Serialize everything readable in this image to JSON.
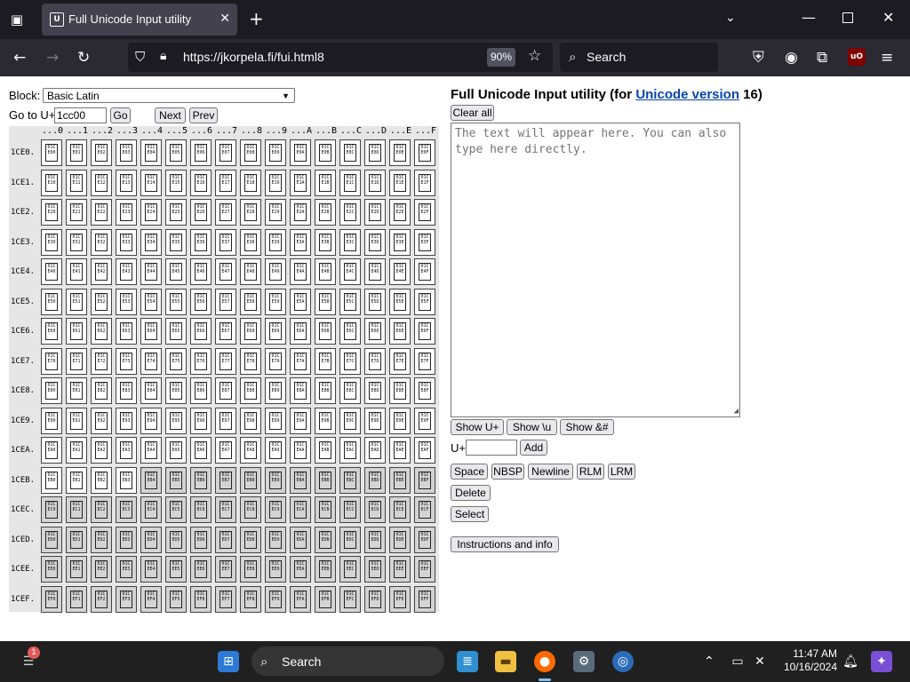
{
  "browser": {
    "tab_title": "Full Unicode Input utility",
    "url": "https://jkorpela.fi/fui.html8",
    "zoom": "90%",
    "search_placeholder": "Search"
  },
  "left": {
    "block_label": "Block:",
    "block_value": "Basic Latin",
    "goto_label": "Go to U+",
    "goto_value": "1cc00",
    "go_button": "Go",
    "next_button": "Next",
    "prev_button": "Prev"
  },
  "grid": {
    "column_headers": [
      "...0",
      "...1",
      "...2",
      "...3",
      "...4",
      "...5",
      "...6",
      "...7",
      "...8",
      "...9",
      "...A",
      "...B",
      "...C",
      "...D",
      "...E",
      "...F"
    ],
    "row_headers": [
      "1CE0.",
      "1CE1.",
      "1CE2.",
      "1CE3.",
      "1CE4.",
      "1CE5.",
      "1CE6.",
      "1CE7.",
      "1CE8.",
      "1CE9.",
      "1CEA.",
      "1CEB.",
      "1CEC.",
      "1CED.",
      "1CEE.",
      "1CEF."
    ],
    "first_gray_index": 180,
    "glyph_prefix": "01C"
  },
  "right": {
    "title_prefix": "Full Unicode Input utility (for ",
    "title_link": "Unicode version",
    "title_suffix": " 16)",
    "clear_all": "Clear all",
    "textarea_placeholder": "The text will appear here. You can also type here directly.",
    "show_uplus": "Show U+",
    "show_u": "Show \\u",
    "show_amp": "Show &#",
    "uplus_label": "U+",
    "add_button": "Add",
    "space_button": "Space",
    "nbsp_button": "NBSP",
    "newline_button": "Newline",
    "rlm_button": "RLM",
    "lrm_button": "LRM",
    "delete_button": "Delete",
    "select_button": "Select",
    "instructions_button": "Instructions and info"
  },
  "taskbar": {
    "search_placeholder": "Search",
    "time": "11:47 AM",
    "date": "10/16/2024",
    "notification_count": "1"
  }
}
